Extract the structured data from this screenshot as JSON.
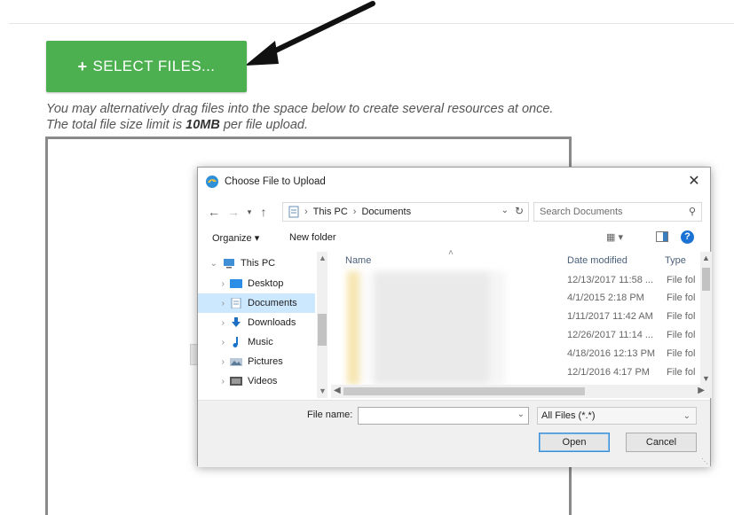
{
  "page": {
    "select_button_label": "SELECT FILES...",
    "plus_glyph": "+",
    "help_pre": "You may alternatively drag files into the space below to create several resources at once. The total file size limit is ",
    "help_bold": "10MB",
    "help_post": " per file upload.",
    "accent_color": "#4caf50"
  },
  "dialog": {
    "title": "Choose File to Upload",
    "close_glyph": "✕",
    "address": {
      "segments": [
        "This PC",
        "Documents"
      ],
      "separator": "›"
    },
    "search_placeholder": "Search Documents",
    "commands": {
      "organize": "Organize ▾",
      "new_folder": "New folder"
    },
    "tree": [
      {
        "label": "This PC",
        "icon": "pc-icon",
        "expanded": true,
        "selected": false
      },
      {
        "label": "Desktop",
        "icon": "desktop-folder-icon",
        "selected": false
      },
      {
        "label": "Documents",
        "icon": "documents-folder-icon",
        "selected": true
      },
      {
        "label": "Downloads",
        "icon": "downloads-folder-icon",
        "selected": false
      },
      {
        "label": "Music",
        "icon": "music-folder-icon",
        "selected": false
      },
      {
        "label": "Pictures",
        "icon": "pictures-folder-icon",
        "selected": false
      },
      {
        "label": "Videos",
        "icon": "videos-folder-icon",
        "selected": false
      }
    ],
    "columns": {
      "name": "Name",
      "date_modified": "Date modified",
      "type": "Type"
    },
    "rows": [
      {
        "date": "12/13/2017 11:58 ...",
        "type": "File fol"
      },
      {
        "date": "4/1/2015 2:18 PM",
        "type": "File fol"
      },
      {
        "date": "1/11/2017 11:42 AM",
        "type": "File fol"
      },
      {
        "date": "12/26/2017 11:14 ...",
        "type": "File fol"
      },
      {
        "date": "4/18/2016 12:13 PM",
        "type": "File fol"
      },
      {
        "date": "12/1/2016 4:17 PM",
        "type": "File fol"
      }
    ],
    "file_name_label": "File name:",
    "file_name_value": "",
    "filter_value": "All Files (*.*)",
    "open_label": "Open",
    "cancel_label": "Cancel"
  }
}
